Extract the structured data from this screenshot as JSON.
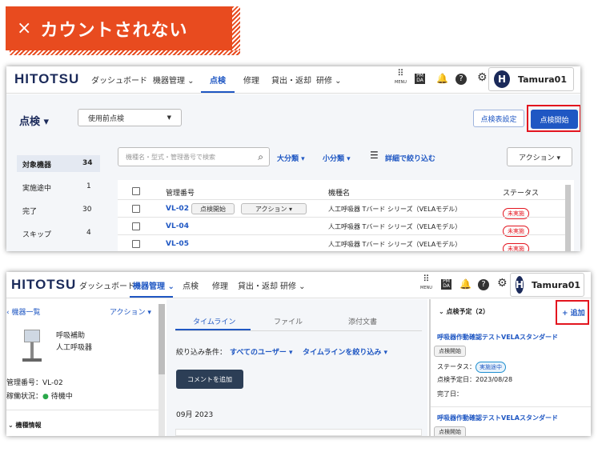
{
  "banner": {
    "x": "×",
    "text": "カウントされない"
  },
  "shot1": {
    "logo": "HITOTSU",
    "nav": [
      "ダッシュボード",
      "機器管理 ⌄",
      "点検",
      "修理",
      "貸出・返却",
      "研修 ⌄"
    ],
    "menu_label": "MENU",
    "pmda": "PM DA",
    "user": {
      "initial": "H",
      "name": "Tamura01"
    },
    "page_title": "点検 ▾",
    "select_value": "使用前点検",
    "settings_button": "点検表設定",
    "start_button": "点検開始",
    "search_placeholder": "機種名・型式・管理番号で検索",
    "filters": [
      "大分類 ▾",
      "小分類 ▾",
      "詳細で絞り込む"
    ],
    "action_button": "アクション ▾",
    "side": [
      {
        "label": "対象機器",
        "count": "34"
      },
      {
        "label": "実施途中",
        "count": "1"
      },
      {
        "label": "完了",
        "count": "30"
      },
      {
        "label": "スキップ",
        "count": "4"
      }
    ],
    "table": {
      "headers": [
        "管理番号",
        "機種名",
        "ステータス"
      ],
      "rows": [
        {
          "id": "VL-02",
          "name": "人工呼吸器 Tバード シリーズ（VELAモデル）",
          "status": "未実施"
        },
        {
          "id": "VL-04",
          "name": "人工呼吸器 Tバード シリーズ（VELAモデル）",
          "status": "未実施"
        },
        {
          "id": "VL-05",
          "name": "人工呼吸器 Tバード シリーズ（VELAモデル）",
          "status": "未実施"
        }
      ],
      "row_start": "点検開始",
      "row_action": "アクション ▾"
    }
  },
  "shot2": {
    "logo": "HITOTSU",
    "nav": [
      "ダッシュボード",
      "機器管理 ⌄",
      "点検",
      "修理",
      "貸出・返却",
      "研修 ⌄"
    ],
    "menu_label": "MENU",
    "pmda": "PM DA",
    "user": {
      "initial": "H",
      "name": "Tamura01"
    },
    "back_link": "‹ 機器一覧",
    "action_link": "アクション ▾",
    "device_name1": "呼吸補助",
    "device_name2": "人工呼吸器",
    "mgmt_no": "管理番号：VL-02",
    "status_label": "稼働状況：",
    "status_value": "待機中",
    "section": "⌄  機種情報",
    "tabs": [
      "タイムライン",
      "ファイル",
      "添付文書"
    ],
    "filter_label": "絞り込み条件：",
    "filter_user": "すべてのユーザー ▾",
    "filter_tl": "タイムラインを絞り込み ▾",
    "comment_button": "コメントを追加",
    "month": "09月 2023",
    "plan_header": "⌄  点検予定（2）",
    "add_link": "+ 追加",
    "plan1": {
      "title": "呼吸器作動確認テストVELAスタンダード",
      "chip": "点検開始",
      "status_label": "ステータス：",
      "status": "実施途中",
      "date": "点検予定日：2023/08/28",
      "done": "完了日："
    },
    "plan2": {
      "title": "呼吸器作動確認テストVELAスタンダード",
      "chip": "点検開始"
    }
  },
  "colors": {
    "banner": "#e84b1f",
    "accent": "#1f57c3",
    "highlight": "#e3151f"
  }
}
